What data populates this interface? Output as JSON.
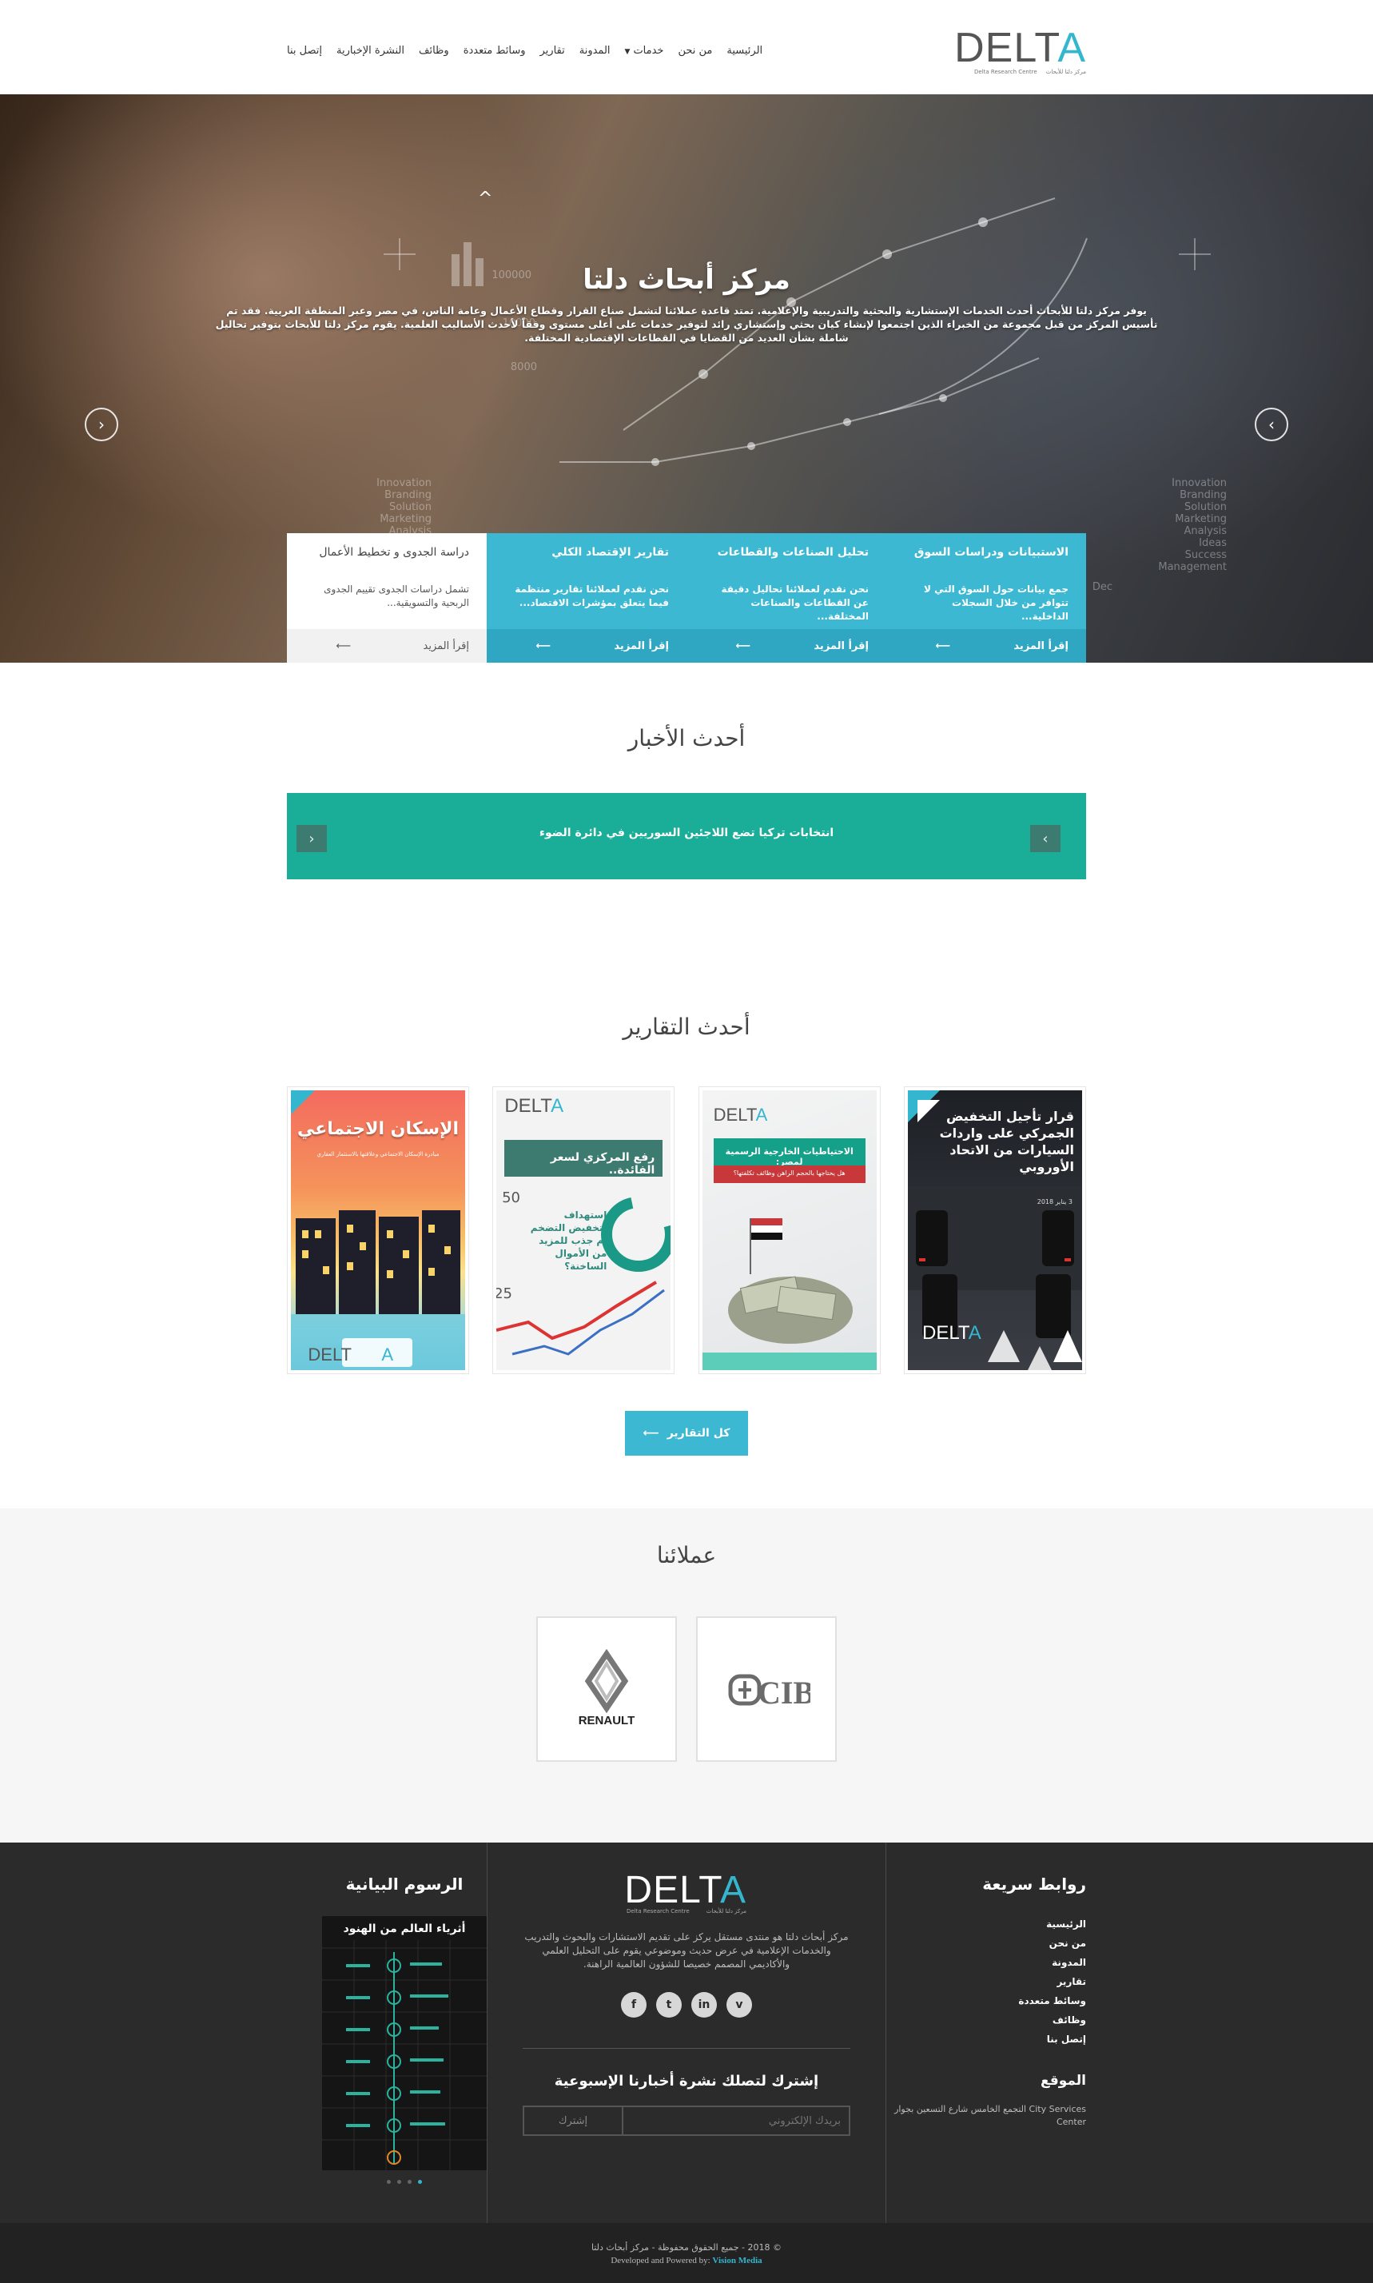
{
  "header": {
    "logo_word": "DELTA",
    "logo_sub_en": "Delta Research Centre",
    "logo_sub_ar": "مركز دلتا للأبحاث",
    "nav": [
      {
        "label": "الرئيسية"
      },
      {
        "label": "من نحن"
      },
      {
        "label": "خدمات"
      },
      {
        "label": "المدونة"
      },
      {
        "label": "تقارير"
      },
      {
        "label": "وسائط متعددة"
      },
      {
        "label": "وظائف"
      },
      {
        "label": "النشرة الإخبارية"
      },
      {
        "label": "إتصل بنا"
      }
    ]
  },
  "hero": {
    "title": "مركز أبحاث دلتا",
    "description": "يوفر مركز دلتا للأبحاث أحدث الخدمات الإستشارية والبحثية والتدريبية والإعلامية. تمتد قاعدة عملائنا لتشمل صناع القرار وقطاع الأعمال وعامة الناس، في مصر وعبر المنطقة العربية. فقد تم تأسيس المركز من قبل مجموعة من الخبراء الذين اجتمعوا لإنشاء كيان بحثي وإستشاري رائد لتوفير خدمات على أعلى مستوى وفقاً لأحدث الأساليب العلمية. يقوم مركز دلتا للأبحاث بتوفير تحاليل شاملة بشأن العديد من القضايا في القطاعات الإقتصادية المختلفة.",
    "cards": [
      {
        "title": "دراسة الجدوى و تخطيط الأعمال",
        "text": "تشمل دراسات الجدوى تقييم الجدوى الربحية والتسويقية...",
        "more": "إقرأ المزيد"
      },
      {
        "title": "تقارير الإقتصاد الكلي",
        "text": "نحن نقدم لعملائنا تقارير منتظمة فيما يتعلق بمؤشرات الاقتصاد...",
        "more": "إقرأ المزيد"
      },
      {
        "title": "تحليل الصناعات والقطاعات",
        "text": "نحن نقدم لعملائنا تحاليل دقيقة عن القطاعات والصناعات المختلفة...",
        "more": "إقرأ المزيد"
      },
      {
        "title": "الاستبيانات ودراسات السوق",
        "text": "جمع بيانات حول السوق التي لا تتوافر من خلال السجلات الداخلية...",
        "more": "إقرأ المزيد"
      }
    ]
  },
  "news": {
    "title": "أحدث الأخبار",
    "headline": "انتخابات تركيا تضع اللاجئين السوريين في دائرة الضوء"
  },
  "reports": {
    "title": "أحدث التقارير",
    "items": [
      {
        "heading": "قرار تأجيل التخفيض الجمركي على واردات السيارات من الاتحاد الأوروبي",
        "date": "3 يناير 2018"
      },
      {
        "heading": "الاحتياطيات الخارجية الرسمية لمصر:",
        "sub": "هل يحتاجها بالحجم الراهن وظائف تكلفتها؟"
      },
      {
        "heading": "رفع المركزي لسعر الفائدة..",
        "sub": "استهداف لتخفيض التضخم أم جذب للمزيد من الأموال الساخنة؟"
      },
      {
        "heading": "الإسكان الاجتماعي",
        "sub": "مبادرة الإسكان الاجتماعي وعلاقتها بالاستثمار العقاري"
      }
    ],
    "all_button": "كل التقارير"
  },
  "clients": {
    "title": "عملائنا",
    "items": [
      {
        "name": "CIB"
      },
      {
        "name": "RENAULT"
      }
    ]
  },
  "footer": {
    "infographics_title": "الرسوم البيانية",
    "infographic_heading": "أثرياء العالم من الهنود",
    "about": "مركز أبحاث دلتا هو منتدى مستقل يركز على تقديم الاستشارات والبحوث والتدريب والخدمات الإعلامية في عرض حديث وموضوعي يقوم على التحليل العلمي والأكاديمي المصمم خصيصا للشؤون العالمية الراهنة.",
    "newsletter_title": "إشترك لتصلك نشرة أخبارنا الإسبوعية",
    "email_placeholder": "بريدك الإلكتروني",
    "subscribe": "إشترك",
    "quick_links_title": "روابط سريعة",
    "quick_links": [
      "الرئيسية",
      "من نحن",
      "المدونة",
      "تقارير",
      "وسائط متعددة",
      "وظائف",
      "إتصل بنا"
    ],
    "location_title": "الموقع",
    "location": "التجمع الخامس شارع التسعين بجوار City Services Center"
  },
  "copyright": {
    "line1": "© 2018 - جميع الحقوق محفوظة - مركز أبحاث دلتا",
    "line2": "Developed and Powered by:",
    "vendor": "Vision Media"
  },
  "colors": {
    "accent": "#3cb8d3",
    "ticker": "#1aad97",
    "footer": "#2b2b2b"
  }
}
